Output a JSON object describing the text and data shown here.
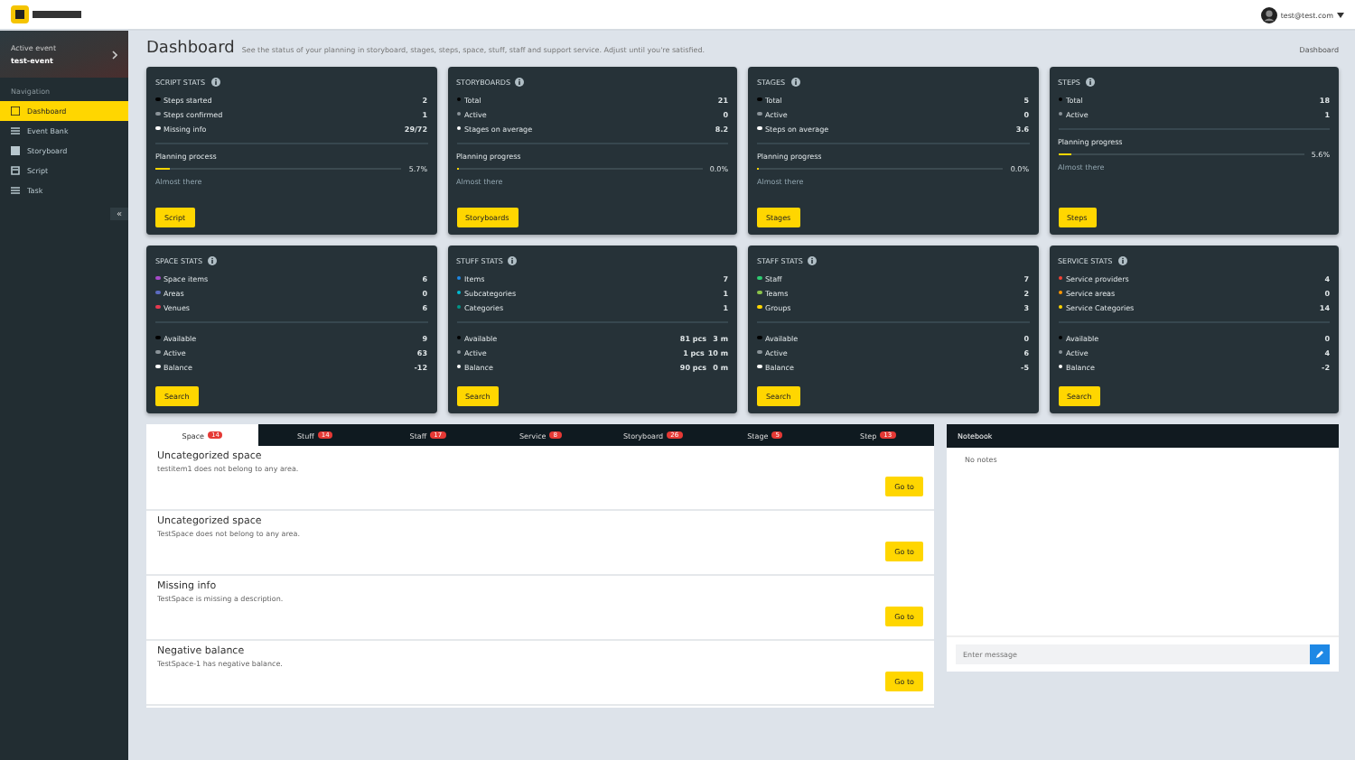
{
  "header": {
    "user_email": "test@test.com"
  },
  "sidebar": {
    "event_label": "Active event",
    "event_name": "test-event",
    "nav_label": "Navigation",
    "items": [
      {
        "label": "Dashboard",
        "selected": true
      },
      {
        "label": "Event Bank",
        "selected": false
      },
      {
        "label": "Storyboard",
        "selected": false
      },
      {
        "label": "Script",
        "selected": false
      },
      {
        "label": "Task",
        "selected": false
      }
    ],
    "collapse": "«"
  },
  "page": {
    "title": "Dashboard",
    "subtitle": "See the status of your planning in storyboard, stages, steps, space, stuff, staff and support service. Adjust until you're satisfied.",
    "breadcrumb": "Dashboard"
  },
  "cards": [
    {
      "title": "SCRIPT STATS",
      "rows": [
        {
          "label": "Steps started",
          "color": "#000000",
          "values": [
            "2"
          ]
        },
        {
          "label": "Steps confirmed",
          "color": "#8a9399",
          "values": [
            "1"
          ]
        },
        {
          "label": "Missing info",
          "color": "#ffffff",
          "values": [
            "29/72"
          ]
        }
      ],
      "progress": {
        "label": "Planning process",
        "value": "5.7%",
        "level": 0.057,
        "note": "Almost there"
      },
      "button": "Script"
    },
    {
      "title": "STORYBOARDS",
      "rows": [
        {
          "label": "Total",
          "color": "#000000",
          "values": [
            "21"
          ]
        },
        {
          "label": "Active",
          "color": "#8a9399",
          "values": [
            "0"
          ]
        },
        {
          "label": "Stages on average",
          "color": "#ffffff",
          "values": [
            "8.2"
          ]
        }
      ],
      "progress": {
        "label": "Planning progress",
        "value": "0.0%",
        "level": 0,
        "note": "Almost there"
      },
      "button": "Storyboards"
    },
    {
      "title": "STAGES",
      "rows": [
        {
          "label": "Total",
          "color": "#000000",
          "values": [
            "5"
          ]
        },
        {
          "label": "Active",
          "color": "#8a9399",
          "values": [
            "0"
          ]
        },
        {
          "label": "Steps on average",
          "color": "#ffffff",
          "values": [
            "3.6"
          ]
        }
      ],
      "progress": {
        "label": "Planning progress",
        "value": "0.0%",
        "level": 0,
        "note": "Almost there"
      },
      "button": "Stages"
    },
    {
      "title": "STEPS",
      "rows": [
        {
          "label": "Total",
          "color": "#000000",
          "values": [
            "18"
          ]
        },
        {
          "label": "Active",
          "color": "#8a9399",
          "values": [
            "1"
          ]
        }
      ],
      "progress": {
        "label": "Planning progress",
        "value": "5.6%",
        "level": 0.056,
        "note": "Almost there"
      },
      "button": "Steps"
    },
    {
      "title": "SPACE STATS",
      "rows": [
        {
          "label": "Space items",
          "color": "#a64ac9",
          "values": [
            "6"
          ]
        },
        {
          "label": "Areas",
          "color": "#5c6bc0",
          "values": [
            "0"
          ]
        },
        {
          "label": "Venues",
          "color": "#e53950",
          "values": [
            "6"
          ]
        }
      ],
      "rows2": [
        {
          "label": "Available",
          "color": "#000000",
          "values": [
            "9"
          ]
        },
        {
          "label": "Active",
          "color": "#8a9399",
          "values": [
            "63"
          ]
        },
        {
          "label": "Balance",
          "color": "#ffffff",
          "values": [
            "-12"
          ]
        }
      ],
      "button": "Search"
    },
    {
      "title": "STUFF STATS",
      "rows": [
        {
          "label": "Items",
          "color": "#1e88e5",
          "values": [
            "7"
          ]
        },
        {
          "label": "Subcategories",
          "color": "#00bcd4",
          "values": [
            "1"
          ]
        },
        {
          "label": "Categories",
          "color": "#009688",
          "values": [
            "1"
          ]
        }
      ],
      "rows2": [
        {
          "label": "Available",
          "color": "#000000",
          "values": [
            "81 pcs",
            "3 m"
          ]
        },
        {
          "label": "Active",
          "color": "#8a9399",
          "values": [
            "1 pcs",
            "10 m"
          ]
        },
        {
          "label": "Balance",
          "color": "#ffffff",
          "values": [
            "90 pcs",
            "0 m"
          ]
        }
      ],
      "button": "Search"
    },
    {
      "title": "STAFF STATS",
      "rows": [
        {
          "label": "Staff",
          "color": "#2ecc71",
          "values": [
            "7"
          ]
        },
        {
          "label": "Teams",
          "color": "#8bc34a",
          "values": [
            "2"
          ]
        },
        {
          "label": "Groups",
          "color": "#ffd600",
          "values": [
            "3"
          ]
        }
      ],
      "rows2": [
        {
          "label": "Available",
          "color": "#000000",
          "values": [
            "0"
          ]
        },
        {
          "label": "Active",
          "color": "#8a9399",
          "values": [
            "6"
          ]
        },
        {
          "label": "Balance",
          "color": "#ffffff",
          "values": [
            "-5"
          ]
        }
      ],
      "button": "Search"
    },
    {
      "title": "SERVICE STATS",
      "rows": [
        {
          "label": "Service providers",
          "color": "#f44336",
          "values": [
            "4"
          ]
        },
        {
          "label": "Service areas",
          "color": "#ff9800",
          "values": [
            "0"
          ]
        },
        {
          "label": "Service Categories",
          "color": "#ffd600",
          "values": [
            "14"
          ]
        }
      ],
      "rows2": [
        {
          "label": "Available",
          "color": "#000000",
          "values": [
            "0"
          ]
        },
        {
          "label": "Active",
          "color": "#8a9399",
          "values": [
            "4"
          ]
        },
        {
          "label": "Balance",
          "color": "#ffffff",
          "values": [
            "-2"
          ]
        }
      ],
      "button": "Search"
    }
  ],
  "issues": {
    "tabs": [
      {
        "label": "Space",
        "count": "14",
        "selected": true
      },
      {
        "label": "Stuff",
        "count": "14",
        "selected": false
      },
      {
        "label": "Staff",
        "count": "17",
        "selected": false
      },
      {
        "label": "Service",
        "count": "8",
        "selected": false
      },
      {
        "label": "Storyboard",
        "count": "26",
        "selected": false
      },
      {
        "label": "Stage",
        "count": "5",
        "selected": false
      },
      {
        "label": "Step",
        "count": "13",
        "selected": false
      }
    ],
    "items": [
      {
        "title": "Uncategorized space",
        "text": "testitem1 does not belong to any area.",
        "button": "Go to"
      },
      {
        "title": "Uncategorized space",
        "text": "TestSpace does not belong to any area.",
        "button": "Go to"
      },
      {
        "title": "Missing info",
        "text": "TestSpace is missing a description.",
        "button": "Go to"
      },
      {
        "title": "Negative balance",
        "text": "TestSpace-1 has negative balance.",
        "button": "Go to"
      }
    ]
  },
  "notebook": {
    "title": "Notebook",
    "empty": "No notes",
    "placeholder": "Enter message"
  }
}
